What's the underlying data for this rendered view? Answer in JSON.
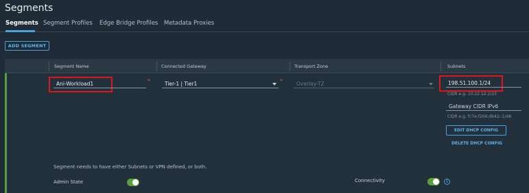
{
  "page": {
    "title": "Segments"
  },
  "tabs": [
    {
      "label": "Segments",
      "active": true
    },
    {
      "label": "Segment Profiles"
    },
    {
      "label": "Edge Bridge Profiles"
    },
    {
      "label": "Metadata Proxies"
    }
  ],
  "toolbar": {
    "add_label": "ADD SEGMENT"
  },
  "table": {
    "headers": [
      "Segment Name",
      "Connected Gateway",
      "Transport Zone",
      "Subnets"
    ]
  },
  "row": {
    "segment_name": "Ani-Workload1",
    "gateway": "Tier-1 | Tier1",
    "transport_zone": "Overlay-TZ",
    "subnet": "198.51.100.1/24",
    "subnet_help": "CIDR e.g. 10.22.12.2/23",
    "gateway_ipv6_placeholder": "Gateway CIDR IPv6",
    "ipv6_help": "CIDR e.g. fc7e:f206:db42::1/48",
    "required_mark": "*"
  },
  "actions": {
    "edit_dhcp": "EDIT DHCP CONFIG",
    "delete_dhcp": "DELETE DHCP CONFIG"
  },
  "footer": {
    "note": "Segment needs to have either Subnets or VPN defined, or both.",
    "admin_state_label": "Admin State",
    "admin_state_on": true,
    "connectivity_label": "Connectivity",
    "connectivity_on": true,
    "info_glyph": "i"
  },
  "colors": {
    "accent": "#4aa3df",
    "toggle_on": "#5aa03b",
    "highlight": "#e1131c",
    "required": "#d9534f"
  }
}
